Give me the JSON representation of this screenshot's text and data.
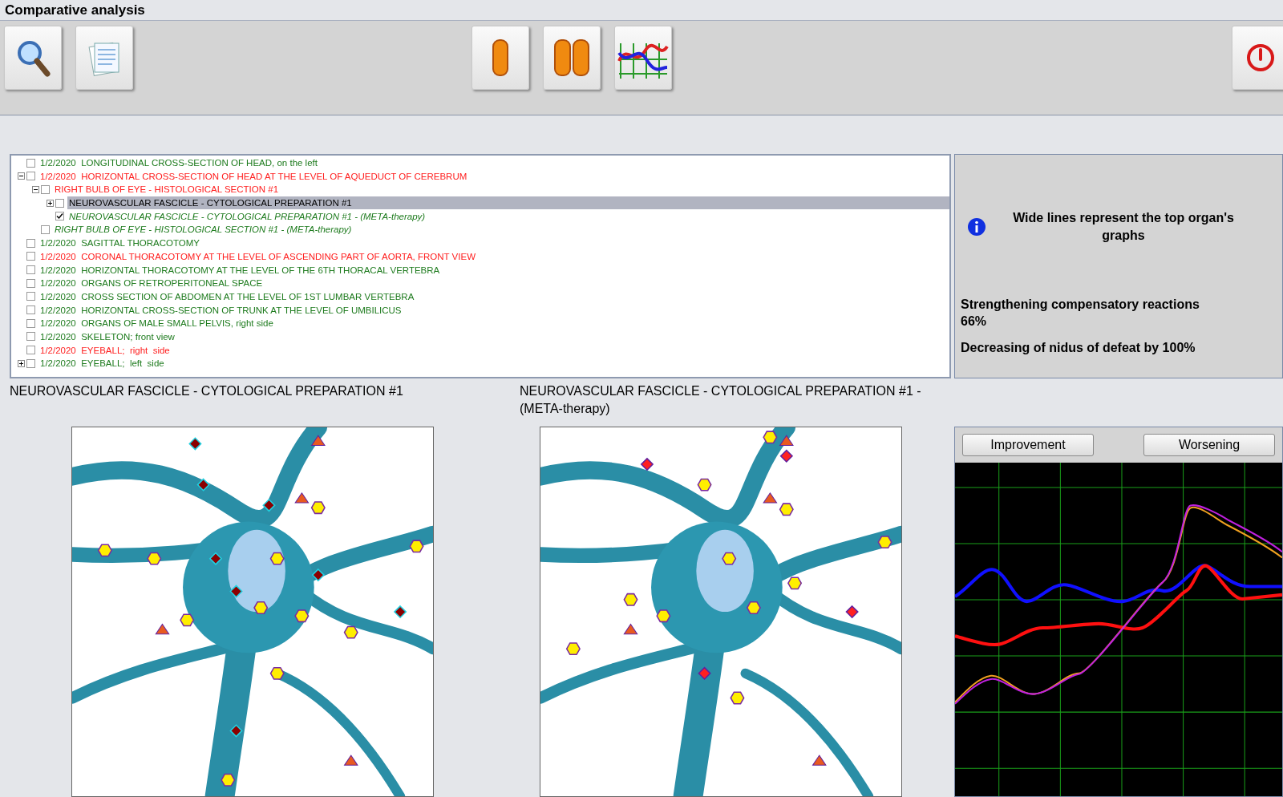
{
  "window": {
    "title": "Comparative analysis"
  },
  "toolbar": [
    {
      "kind": "search"
    },
    {
      "kind": "notes"
    },
    {
      "kind": "single"
    },
    {
      "kind": "double"
    },
    {
      "kind": "graph"
    },
    {
      "kind": "power"
    }
  ],
  "tree": [
    {
      "label": "1/2/2020  LONGITUDINAL CROSS-SECTION OF HEAD, on the left",
      "kind": "record",
      "color": "#1e7b1e",
      "checked": false,
      "selected": false
    },
    {
      "label": "1/2/2020  HORIZONTAL CROSS-SECTION OF HEAD AT THE LEVEL OF AQUEDUCT OF CEREBRUM",
      "kind": "record",
      "color": "#ff2020",
      "checked": false,
      "selected": false,
      "expanded": true,
      "children": [
        {
          "label": "RIGHT BULB OF EYE - HISTOLOGICAL SECTION #1",
          "kind": "record",
          "color": "#ff2020",
          "checked": false,
          "selected": false,
          "expanded": true,
          "children": [
            {
              "label": "NEUROVASCULAR FASCICLE - CYTOLOGICAL PREPARATION #1",
              "kind": "record",
              "color": "#000000",
              "checked": false,
              "selected": true,
              "expanded": false
            },
            {
              "label": "NEUROVASCULAR FASCICLE - CYTOLOGICAL PREPARATION #1 - (META-therapy)",
              "kind": "meta",
              "color": "#1e7b1e",
              "checked": true,
              "selected": false
            }
          ]
        },
        {
          "label": "RIGHT BULB OF EYE - HISTOLOGICAL SECTION #1 - (META-therapy)",
          "kind": "meta",
          "color": "#1e7b1e",
          "checked": false,
          "selected": false
        }
      ]
    },
    {
      "label": "1/2/2020  SAGITTAL THORACOTOMY",
      "kind": "record",
      "color": "#1e7b1e",
      "checked": false,
      "selected": false
    },
    {
      "label": "1/2/2020  CORONAL THORACOTOMY AT THE LEVEL OF ASCENDING PART OF AORTA, FRONT VIEW",
      "kind": "record",
      "color": "#ff2020",
      "checked": false,
      "selected": false
    },
    {
      "label": "1/2/2020  HORIZONTAL THORACOTOMY AT THE LEVEL OF THE 6TH THORACAL VERTEBRA",
      "kind": "record",
      "color": "#1e7b1e",
      "checked": false,
      "selected": false
    },
    {
      "label": "1/2/2020  ORGANS OF RETROPERITONEAL SPACE",
      "kind": "record",
      "color": "#1e7b1e",
      "checked": false,
      "selected": false
    },
    {
      "label": "1/2/2020  CROSS SECTION OF ABDOMEN AT THE LEVEL OF 1ST LUMBAR VERTEBRA",
      "kind": "record",
      "color": "#1e7b1e",
      "checked": false,
      "selected": false
    },
    {
      "label": "1/2/2020  HORIZONTAL CROSS-SECTION OF TRUNK AT THE LEVEL OF UMBILICUS",
      "kind": "record",
      "color": "#1e7b1e",
      "checked": false,
      "selected": false
    },
    {
      "label": "1/2/2020  ORGANS OF MALE SMALL PELVIS, right side",
      "kind": "record",
      "color": "#1e7b1e",
      "checked": false,
      "selected": false
    },
    {
      "label": "1/2/2020  SKELETON; front view",
      "kind": "record",
      "color": "#1e7b1e",
      "checked": false,
      "selected": false
    },
    {
      "label": "1/2/2020  EYEBALL;  right  side",
      "kind": "record",
      "color": "#ff2020",
      "checked": false,
      "selected": false
    },
    {
      "label": "1/2/2020  EYEBALL;  left  side",
      "kind": "record",
      "color": "#1e7b1e",
      "checked": false,
      "selected": false,
      "expanded": false
    }
  ],
  "info": {
    "note": "Wide lines represent the top organ's graphs",
    "results": [
      "Strengthening compensatory reactions 66%",
      "Decreasing of nidus of defeat by 100%"
    ]
  },
  "panels": [
    {
      "caption": "NEUROVASCULAR FASCICLE - CYTOLOGICAL PREPARATION #1"
    },
    {
      "caption": "NEUROVASCULAR FASCICLE - CYTOLOGICAL PREPARATION #1 - (META-therapy)"
    }
  ],
  "chart": {
    "buttons": [
      "Improvement",
      "Worsening"
    ]
  }
}
